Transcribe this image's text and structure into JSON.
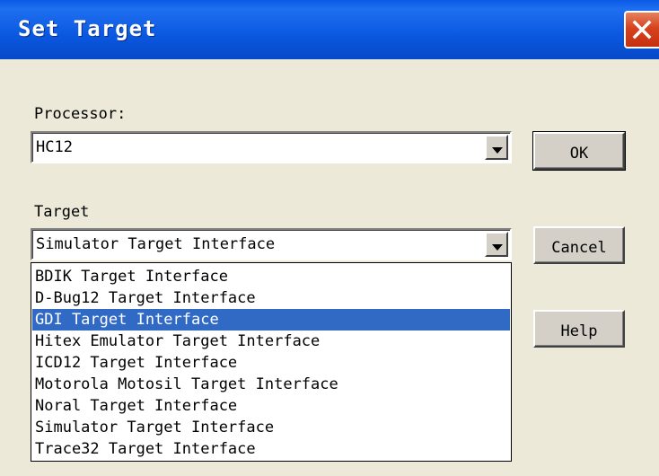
{
  "dialog": {
    "title": "Set Target"
  },
  "processor": {
    "label": "Processor",
    "value": "HC12"
  },
  "target": {
    "label": "Target",
    "value": "Simulator Target Interface",
    "options": [
      "BDIK Target Interface",
      "D-Bug12 Target Interface",
      "GDI Target Interface",
      "Hitex Emulator Target Interface",
      "ICD12 Target Interface",
      "Motorola Motosil Target Interface",
      "Noral Target Interface",
      "Simulator Target Interface",
      "Trace32 Target Interface"
    ],
    "highlighted_index": 2
  },
  "buttons": {
    "ok": "OK",
    "cancel": "Cancel",
    "help": "Help"
  },
  "colors": {
    "titlebar": "#0a58e0",
    "dialog_bg": "#ece9d8",
    "selection": "#316ac5",
    "close_button": "#d7421e"
  }
}
